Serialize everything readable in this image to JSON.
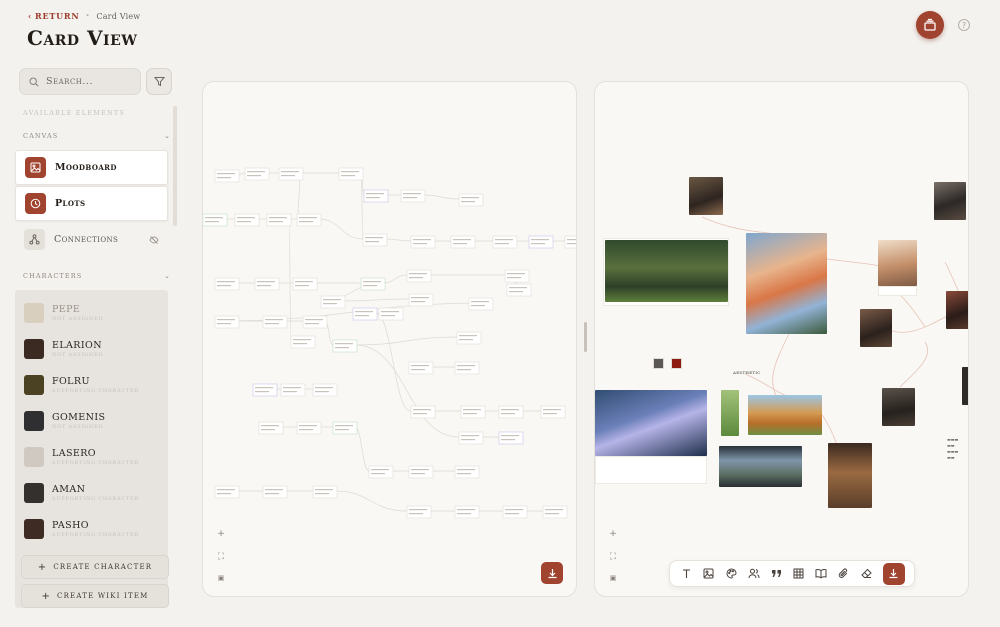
{
  "breadcrumb": {
    "return_label": "RETURN",
    "separator": "•",
    "current": "Card View"
  },
  "page": {
    "title": "Card View"
  },
  "search": {
    "placeholder": "Search..."
  },
  "sidebar": {
    "available_label": "AVAILABLE ELEMENTS",
    "canvas_section": "CANVAS",
    "characters_section": "CHARACTERS",
    "canvas_items": [
      {
        "label": "Moodboard",
        "icon": "image-icon"
      },
      {
        "label": "Plots",
        "icon": "clock-icon"
      },
      {
        "label": "Connections",
        "icon": "share-icon"
      }
    ],
    "characters": [
      {
        "name": "PEPE",
        "subtitle": "NOT ASSIGNED",
        "color": "#d8cfbe"
      },
      {
        "name": "ELARION",
        "subtitle": "NOT ASSIGNED",
        "color": "#3b2a22"
      },
      {
        "name": "FOLRU",
        "subtitle": "SUPPORTING CHARACTER",
        "color": "#4a4222"
      },
      {
        "name": "GOMENIS",
        "subtitle": "NOT ASSIGNED",
        "color": "#2f2e30"
      },
      {
        "name": "LASERO",
        "subtitle": "SUPPORTING CHARACTER",
        "color": "#cfc9c2"
      },
      {
        "name": "AMAN",
        "subtitle": "SUPPORTING CHARACTER",
        "color": "#33302d"
      },
      {
        "name": "PASHO",
        "subtitle": "SUPPORTING CHARACTER",
        "color": "#3d2b24"
      }
    ],
    "create_character": "CREATE CHARACTER",
    "create_wiki": "CREATE WIKI ITEM"
  },
  "moodboard": {
    "tag_label": "AESTHETIC"
  },
  "zoom": {
    "plus": "+",
    "fit": "⛶"
  },
  "colors": {
    "accent": "#a0432f",
    "background": "#f4f2ee",
    "panel": "#f9f8f5"
  },
  "toolbar": {
    "tools": [
      "text-icon",
      "image-icon",
      "palette-icon",
      "people-icon",
      "quote-icon",
      "table-icon",
      "book-icon",
      "attachment-icon",
      "eraser-icon",
      "download-icon"
    ]
  }
}
